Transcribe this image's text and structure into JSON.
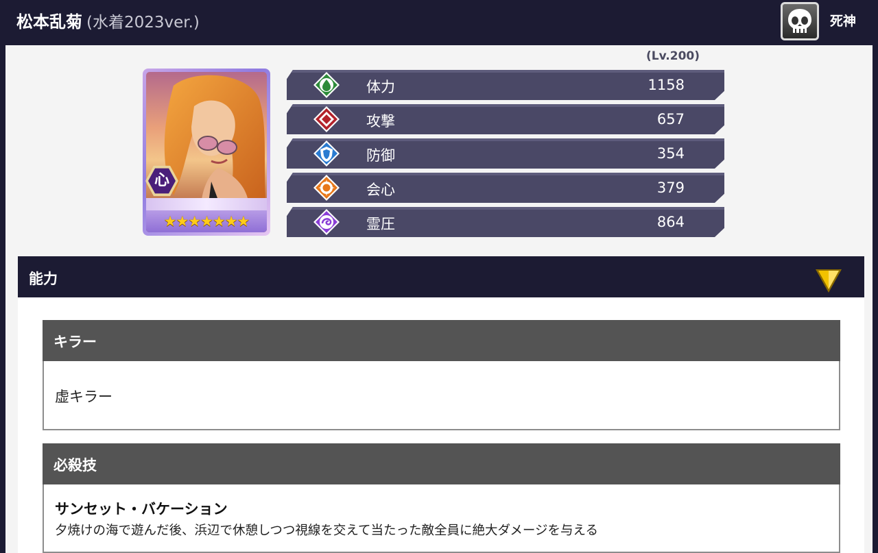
{
  "header": {
    "name": "松本乱菊",
    "variant": "(水着2023ver.)",
    "faction_icon": "skull-icon",
    "faction_label": "死神"
  },
  "card": {
    "attribute_label": "心",
    "stars_display": "★★★★★★★",
    "rarity_stars": 7
  },
  "level_label": "(Lv.200)",
  "stats": [
    {
      "label": "体力",
      "value": "1158",
      "icon": "hp-icon",
      "color": "#2e8b3a"
    },
    {
      "label": "攻撃",
      "value": "657",
      "icon": "attack-icon",
      "color": "#b3222a"
    },
    {
      "label": "防御",
      "value": "354",
      "icon": "defense-icon",
      "color": "#2a7bd0"
    },
    {
      "label": "会心",
      "value": "379",
      "icon": "critical-icon",
      "color": "#e8781a"
    },
    {
      "label": "霊圧",
      "value": "864",
      "icon": "spirit-pressure-icon",
      "color": "#8a3ed6"
    }
  ],
  "ability": {
    "title": "能力",
    "toggle_icon": "triangle-down-icon",
    "killer": {
      "heading": "キラー",
      "text": "虚キラー"
    },
    "special": {
      "heading": "必殺技",
      "name": "サンセット・バケーション",
      "description": "夕焼けの海で遊んだ後、浜辺で休憩しつつ視線を交えて当たった敵全員に絶大ダメージを与える"
    }
  },
  "colors": {
    "header_bg": "#1c1b33",
    "stat_row_bg": "#4a4866",
    "box_head_bg": "#545454",
    "accent_gold": "#f2c200"
  }
}
